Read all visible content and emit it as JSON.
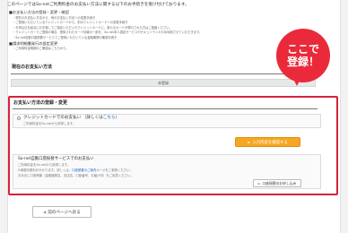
{
  "intro": {
    "line1": "このページではSo-netご利用料金のお支払い方法に関する以下のお手続きを受け付けております。"
  },
  "info": {
    "heading": "■お支払い方法の登録・変更・確認",
    "items": [
      "・現在のお支払い方法から、他のお支払い方法への変更手続き",
      "・ご登録いただいているクレジットカードから、別のクレジットカードへの変更手続き",
      "・お申込日を起点にお引落しでご指定いただいたクレジットカードに、新たなカードが発行された方はご連絡ください。",
      "・クレジットカードご登録の場合、登録されたカード情報の一部を、So-net本人認証サービスやセキュリティのため利用させていただきます。",
      "・So-net自動口座振替サービスでご登録いただいている金融機関の確認手続き",
      "■請求明細書発行の設定変更",
      "・ご利用料金明細のご確認はこちらから。"
    ]
  },
  "current": {
    "title": "現在のお支払い方法",
    "value": "未登録"
  },
  "register": {
    "title": "お支払い方法の登録・変更",
    "card_label": "クレジットカードでのお支払い",
    "card_paren_open": "（詳しくは",
    "card_link": "こちら",
    "card_paren_close": "）",
    "card_note": "ご利用料金をSo-netから請求します。",
    "confirm_button": "入力内容を確認する",
    "bank_title": "So-net自動口座振替サービスでのお支払い",
    "bank_line1": "ご利用料金をSo-netから請求します。",
    "bank_line2_pre": "※事務手数料がかかります。詳しくは、",
    "bank_line2_link": "口座振替のご案内ページ",
    "bank_line2_post": "をご参照ください。",
    "bank_line3": "お手元に口座情報（金融機関名、支店名、口座番号、お届け印）をご用意ください。",
    "bank_button": "口座振替のお申し込み"
  },
  "back_button": "前のページへ戻る",
  "balloon": {
    "line1": "ここで",
    "line2": "登録！"
  },
  "colors": {
    "accent_red": "#d8213b",
    "button_orange": "#f5a623",
    "link_blue": "#1565c0"
  }
}
